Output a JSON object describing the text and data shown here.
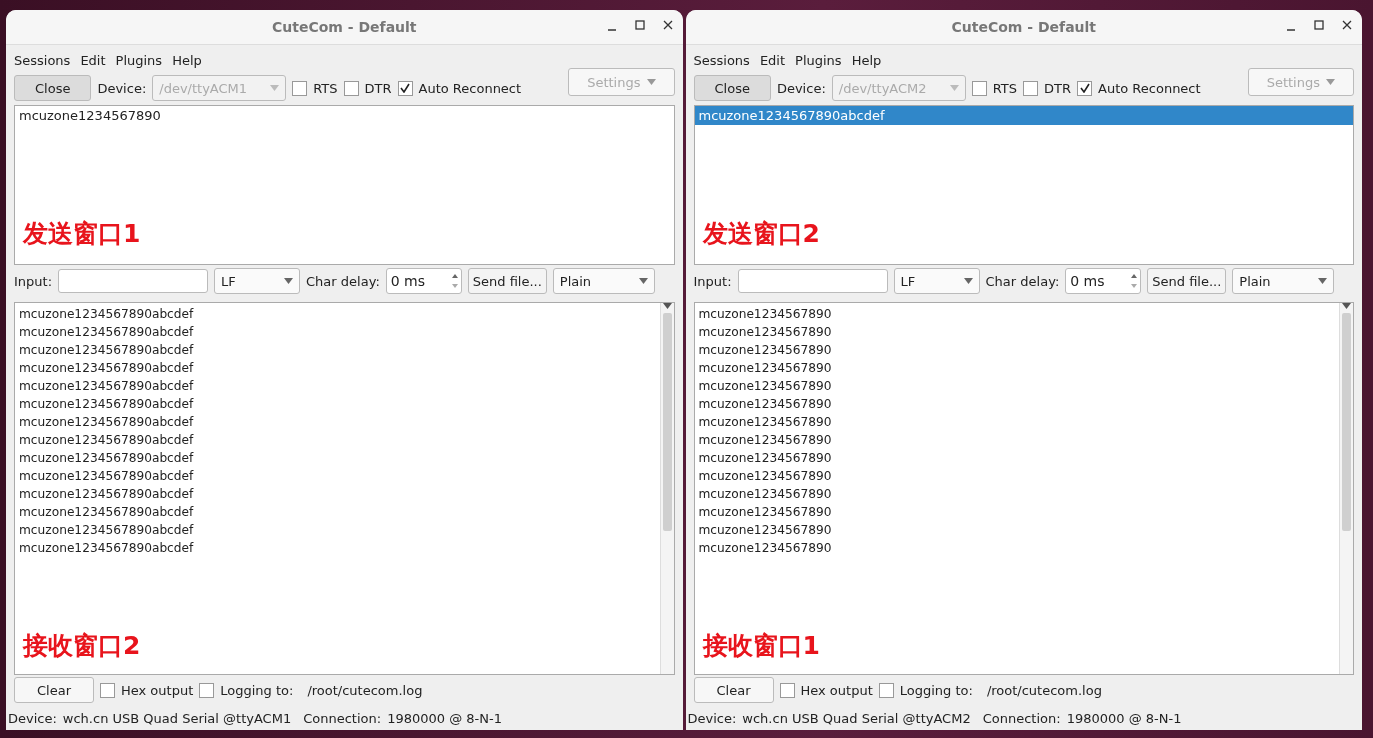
{
  "windows": [
    {
      "title": "CuteCom - Default",
      "menu": [
        "Sessions",
        "Edit",
        "Plugins",
        "Help"
      ],
      "close_button": "Close",
      "device_label": "Device:",
      "device": "/dev/ttyACM1",
      "options": [
        {
          "label": "RTS",
          "checked": false
        },
        {
          "label": "DTR",
          "checked": false
        },
        {
          "label": "Auto Reconnect",
          "checked": true
        }
      ],
      "settings": "Settings",
      "history": [
        {
          "text": "mcuzone1234567890",
          "selected": false
        }
      ],
      "history_note": "发送窗口1",
      "input_label": "Input:",
      "line_end": "LF",
      "char_delay_label": "Char delay:",
      "char_delay": "0 ms",
      "send_file": "Send file...",
      "format": "Plain",
      "output_lines": [
        "mcuzone1234567890abcdef",
        "mcuzone1234567890abcdef",
        "mcuzone1234567890abcdef",
        "mcuzone1234567890abcdef",
        "mcuzone1234567890abcdef",
        "mcuzone1234567890abcdef",
        "mcuzone1234567890abcdef",
        "mcuzone1234567890abcdef",
        "mcuzone1234567890abcdef",
        "mcuzone1234567890abcdef",
        "mcuzone1234567890abcdef",
        "mcuzone1234567890abcdef",
        "mcuzone1234567890abcdef",
        "mcuzone1234567890abcdef"
      ],
      "output_note": "接收窗口2",
      "clear": "Clear",
      "bottom_options": [
        {
          "label": "Hex output",
          "checked": false
        },
        {
          "label": "Logging to:",
          "checked": false
        }
      ],
      "log_path": "/root/cutecom.log",
      "status": {
        "device_label": "Device:",
        "device": "wch.cn USB Quad Serial @ttyACM1",
        "connection_label": "Connection:",
        "connection": "1980000 @ 8-N-1"
      }
    },
    {
      "title": "CuteCom - Default",
      "menu": [
        "Sessions",
        "Edit",
        "Plugins",
        "Help"
      ],
      "close_button": "Close",
      "device_label": "Device:",
      "device": "/dev/ttyACM2",
      "options": [
        {
          "label": "RTS",
          "checked": false
        },
        {
          "label": "DTR",
          "checked": false
        },
        {
          "label": "Auto Reconnect",
          "checked": true
        }
      ],
      "settings": "Settings",
      "history": [
        {
          "text": "mcuzone1234567890abcdef",
          "selected": true
        }
      ],
      "history_note": "发送窗口2",
      "input_label": "Input:",
      "line_end": "LF",
      "char_delay_label": "Char delay:",
      "char_delay": "0 ms",
      "send_file": "Send file...",
      "format": "Plain",
      "output_lines": [
        "mcuzone1234567890",
        "mcuzone1234567890",
        "mcuzone1234567890",
        "mcuzone1234567890",
        "mcuzone1234567890",
        "mcuzone1234567890",
        "mcuzone1234567890",
        "mcuzone1234567890",
        "mcuzone1234567890",
        "mcuzone1234567890",
        "mcuzone1234567890",
        "mcuzone1234567890",
        "mcuzone1234567890",
        "mcuzone1234567890"
      ],
      "output_note": "接收窗口1",
      "clear": "Clear",
      "bottom_options": [
        {
          "label": "Hex output",
          "checked": false
        },
        {
          "label": "Logging to:",
          "checked": false
        }
      ],
      "log_path": "/root/cutecom.log",
      "status": {
        "device_label": "Device:",
        "device": "wch.cn USB Quad Serial @ttyACM2",
        "connection_label": "Connection:",
        "connection": "1980000 @ 8-N-1"
      }
    }
  ]
}
